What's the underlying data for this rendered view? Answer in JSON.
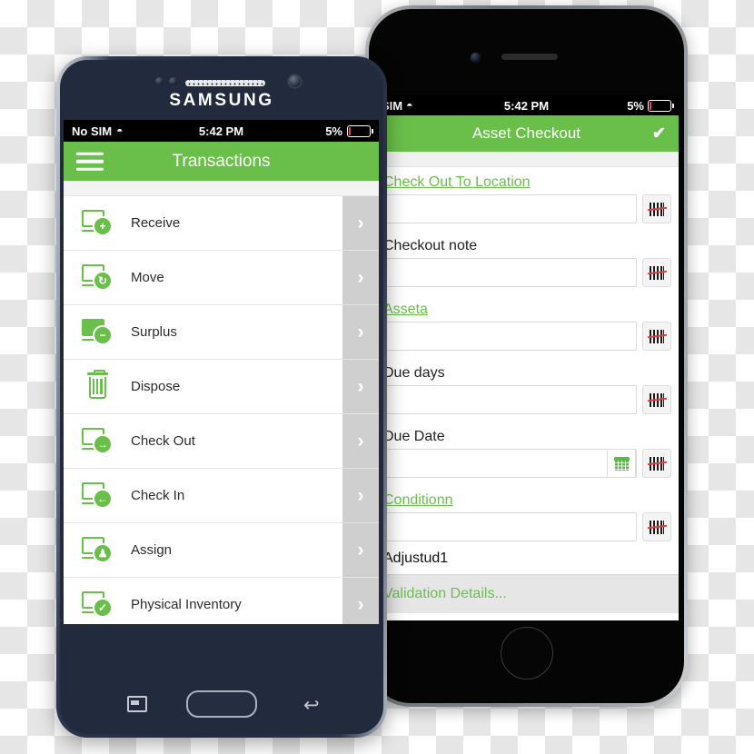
{
  "samsung": {
    "brand": "SAMSUNG",
    "status_bar": {
      "carrier": "No SIM",
      "wifi_icon": "wifi-icon",
      "time": "5:42 PM",
      "battery_percent": "5%"
    },
    "app_bar": {
      "menu_icon": "hamburger-menu-icon",
      "title": "Transactions"
    },
    "list": [
      {
        "label": "Receive",
        "icon": "monitor-plus-icon",
        "badge": "+",
        "chevron": "›"
      },
      {
        "label": "Move",
        "icon": "monitor-refresh-icon",
        "badge": "↻",
        "chevron": "›"
      },
      {
        "label": "Surplus",
        "icon": "monitor-minus-icon",
        "badge": "−",
        "chevron": "›"
      },
      {
        "label": "Dispose",
        "icon": "trash-can-icon",
        "badge": "",
        "chevron": "›"
      },
      {
        "label": "Check Out",
        "icon": "monitor-arrow-right-icon",
        "badge": "→",
        "chevron": "›"
      },
      {
        "label": "Check In",
        "icon": "monitor-arrow-left-icon",
        "badge": "←",
        "chevron": "›"
      },
      {
        "label": "Assign",
        "icon": "monitor-person-icon",
        "badge": "♟",
        "chevron": "›"
      },
      {
        "label": "Physical Inventory",
        "icon": "monitor-check-icon",
        "badge": "✓",
        "chevron": "›"
      }
    ],
    "nav": {
      "recents_icon": "recents-icon",
      "home_button": "home-button",
      "back_icon": "back-icon"
    }
  },
  "iphone": {
    "status_bar": {
      "carrier": "SIM",
      "wifi_icon": "wifi-icon",
      "time": "5:42 PM",
      "battery_percent": "5%"
    },
    "app_bar": {
      "menu_icon": "hamburger-menu-icon",
      "title": "Asset Checkout",
      "confirm_icon": "checkmark-icon"
    },
    "fields": [
      {
        "label": "Check Out To Location",
        "is_link": true,
        "value": "",
        "scan_icon": "barcode-scan-icon",
        "has_calendar": false
      },
      {
        "label": "Checkout note",
        "is_link": false,
        "value": "",
        "scan_icon": "barcode-scan-icon",
        "has_calendar": false
      },
      {
        "label": "Asseta",
        "is_link": true,
        "value": "",
        "scan_icon": "barcode-scan-icon",
        "has_calendar": false
      },
      {
        "label": "Due days",
        "is_link": false,
        "value": "",
        "scan_icon": "barcode-scan-icon",
        "has_calendar": false
      },
      {
        "label": "Due Date",
        "is_link": false,
        "value": "",
        "scan_icon": "barcode-scan-icon",
        "has_calendar": true,
        "calendar_icon": "calendar-icon"
      },
      {
        "label": "Conditionn",
        "is_link": true,
        "value": "",
        "scan_icon": "barcode-scan-icon",
        "has_calendar": false
      }
    ],
    "adjust_text": "Adjustud1",
    "validation_text": "Validation Details...",
    "home_button": "home-button"
  },
  "colors": {
    "brand_green": "#6abf4b",
    "status_black": "#000000",
    "chevron_strip": "#cfcfcf",
    "barcode_red": "#e03c3c"
  }
}
